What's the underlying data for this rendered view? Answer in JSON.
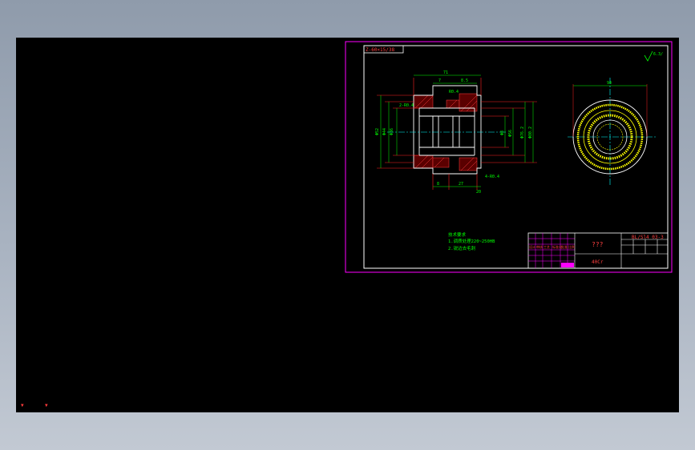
{
  "colors": {
    "frame": "#ff00ff",
    "border": "#ffffff",
    "outline": "#ff2020",
    "dimension": "#00ff00",
    "centerline": "#00ffff",
    "hatch": "#ff4040",
    "gear": "#ffff00",
    "note": "#00ff00",
    "titleblock": "#ff00ff",
    "title_text": "#ff4040"
  },
  "sheet": {
    "corner_tag": "Z-60×15/38",
    "roughness_mark": "6.3/"
  },
  "section_view": {
    "dims_top": [
      "71",
      "7",
      "8.5"
    ],
    "dims_left": [
      "Φ36",
      "Φ44",
      "Φ52"
    ],
    "dims_right": [
      "Φ8",
      "Φ56",
      "Φ76.2",
      "Φ80.2"
    ],
    "dims_bottom": [
      "8",
      "27",
      "20"
    ],
    "chamfer_labels": [
      "2-R0.4",
      "R0.4",
      "4-R0.4"
    ]
  },
  "end_view": {
    "dim_top": "94"
  },
  "notes": {
    "heading": "技术要求",
    "line1": "1.调质处理220~250HB",
    "line2": "2.锐边去毛刺"
  },
  "titleblock": {
    "part_name": "???",
    "drawing_no": "BL/Sl4 03-3",
    "material": "40Cr",
    "grid_labels": [
      "设计",
      "审核",
      "工艺",
      "标准化",
      "批准",
      "比例"
    ]
  },
  "viewport_marks": {
    "left": "▼",
    "right": "▼"
  }
}
